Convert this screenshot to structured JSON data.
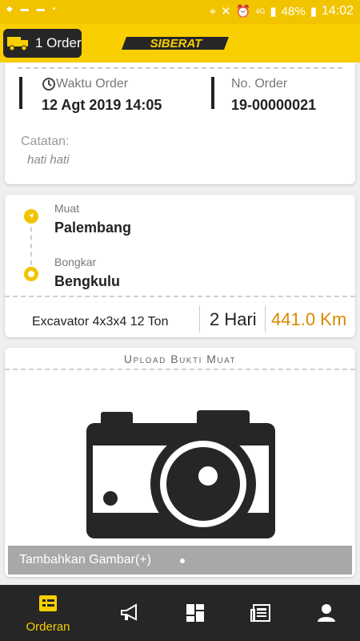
{
  "status_bar": {
    "battery": "48%",
    "time": "14:02",
    "network": "4G"
  },
  "app_bar": {
    "order_button_label": "1 Order",
    "logo_text": "SIBERAT"
  },
  "order_info": {
    "time_label": "Waktu Order",
    "time_value": "12 Agt 2019 14:05",
    "number_label": "No. Order",
    "number_value": "19-00000021",
    "note_label": "Catatan:",
    "note_value": "hati hati"
  },
  "route": {
    "pickup_label": "Muat",
    "pickup_value": "Palembang",
    "drop_label": "Bongkar",
    "drop_value": "Bengkulu",
    "vehicle": "Excavator 4x3x4 12 Ton",
    "duration": "2 Hari",
    "distance": "441.0 Km"
  },
  "upload": {
    "title": "Upload Bukti Muat",
    "add_label": "Tambahkan Gambar(+)"
  },
  "bottom_nav": {
    "items": [
      {
        "label": "Orderan",
        "icon": "orders-icon",
        "active": true
      },
      {
        "label": "",
        "icon": "megaphone-icon",
        "active": false
      },
      {
        "label": "",
        "icon": "dashboard-icon",
        "active": false
      },
      {
        "label": "",
        "icon": "newspaper-icon",
        "active": false
      },
      {
        "label": "",
        "icon": "profile-icon",
        "active": false
      }
    ]
  },
  "colors": {
    "brand_yellow": "#f9cf02",
    "dark": "#262626",
    "distance": "#d98a00"
  }
}
